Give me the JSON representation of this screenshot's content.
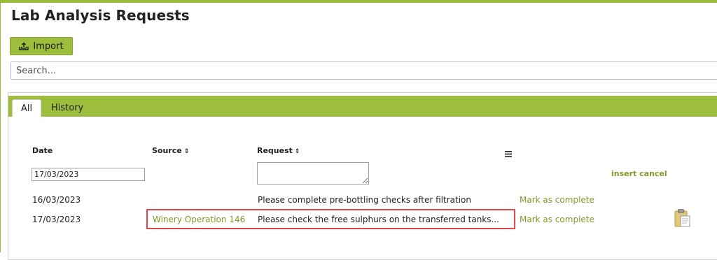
{
  "page": {
    "title": "Lab Analysis Requests"
  },
  "toolbar": {
    "import_label": "Import"
  },
  "search": {
    "placeholder": "Search..."
  },
  "tabs": [
    {
      "label": "All",
      "active": true
    },
    {
      "label": "History",
      "active": false
    }
  ],
  "table": {
    "columns": [
      {
        "label": "Date",
        "sortable": false
      },
      {
        "label": "Source",
        "sortable": true
      },
      {
        "label": "Request",
        "sortable": true
      }
    ],
    "new_row": {
      "date_value": "17/03/2023",
      "request_value": "",
      "insert_label": "insert",
      "cancel_label": "cancel"
    },
    "rows": [
      {
        "date": "16/03/2023",
        "source": "",
        "request": "Please complete pre-bottling checks after filtration",
        "action": "Mark as complete",
        "has_clipboard": false
      },
      {
        "date": "17/03/2023",
        "source": "Winery Operation 146",
        "request": "Please check the free sulphurs on the transferred tanks...",
        "action": "Mark as complete",
        "has_clipboard": true
      }
    ]
  },
  "colors": {
    "accent": "#9dbd3c",
    "link": "#7d9a2a",
    "highlight": "#e0474c"
  },
  "icons": [
    "import-icon",
    "sort-icon",
    "column-menu-icon",
    "clipboard-icon"
  ]
}
